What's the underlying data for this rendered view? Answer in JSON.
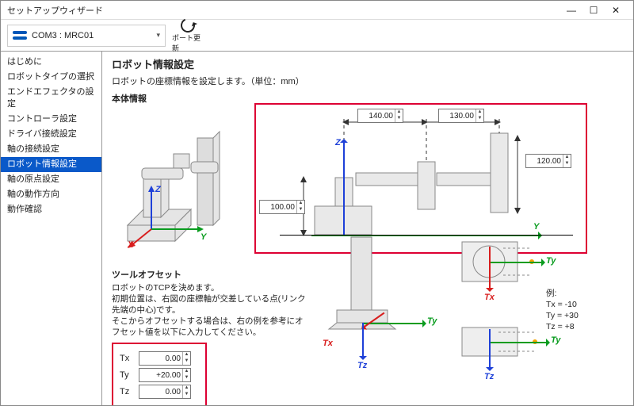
{
  "window": {
    "title": "セットアップウィザード"
  },
  "toolbar": {
    "port_label": "COM3 : MRC01",
    "refresh_label": "ポート更新"
  },
  "sidebar": {
    "items": [
      {
        "label": "はじめに"
      },
      {
        "label": "ロボットタイプの選択"
      },
      {
        "label": "エンドエフェクタの設定"
      },
      {
        "label": "コントローラ設定"
      },
      {
        "label": "ドライバ接続設定"
      },
      {
        "label": "軸の接続設定"
      },
      {
        "label": "ロボット情報設定"
      },
      {
        "label": "軸の原点設定"
      },
      {
        "label": "軸の動作方向"
      },
      {
        "label": "動作確認"
      }
    ],
    "active_index": 6
  },
  "main": {
    "heading": "ロボット情報設定",
    "description": "ロボットの座標情報を設定します。（単位：mm）",
    "body_heading": "本体情報",
    "dims": {
      "base_height": "100.00",
      "link1": "140.00",
      "link2": "130.00",
      "link2_height": "120.00"
    },
    "axis": {
      "x": "X",
      "y": "Y",
      "z": "Z"
    },
    "tool": {
      "heading": "ツールオフセット",
      "line1": "ロボットのTCPを決めます。",
      "line2": "初期位置は、右図の座標軸が交差している点(リンク先端の中心)です。",
      "line3": "そこからオフセットする場合は、右の例を参考にオフセット値を以下に入力してください。",
      "tx_label": "Tx",
      "ty_label": "Ty",
      "tz_label": "Tz",
      "tx_value": "0.00",
      "ty_value": "+20.00",
      "tz_value": "0.00",
      "example_heading": "例:",
      "ex_tx": "Tx = -10",
      "ex_ty": "Ty = +30",
      "ex_tz": "Tz = +8"
    }
  }
}
